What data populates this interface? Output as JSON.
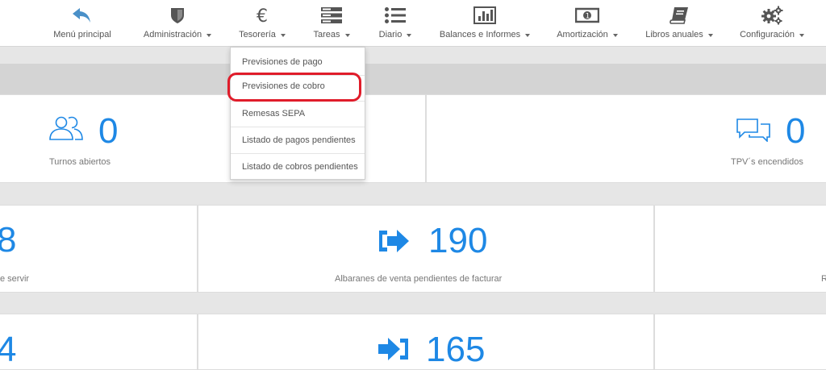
{
  "nav": {
    "items": [
      {
        "label": "Menú principal",
        "has_caret": false,
        "icon": "arrow-back-icon"
      },
      {
        "label": "Administración",
        "has_caret": true,
        "icon": "shield-icon"
      },
      {
        "label": "Tesorería",
        "has_caret": true,
        "icon": "euro-icon"
      },
      {
        "label": "Tareas",
        "has_caret": true,
        "icon": "server-icon"
      },
      {
        "label": "Diario",
        "has_caret": true,
        "icon": "list-icon"
      },
      {
        "label": "Balances e Informes",
        "has_caret": true,
        "icon": "bar-chart-icon"
      },
      {
        "label": "Amortización",
        "has_caret": true,
        "icon": "money-icon"
      },
      {
        "label": "Libros anuales",
        "has_caret": true,
        "icon": "book-icon"
      },
      {
        "label": "Configuración",
        "has_caret": true,
        "icon": "gears-icon"
      }
    ]
  },
  "dropdown": {
    "items": [
      "Previsiones de pago",
      "Previsiones de cobro",
      "Remesas SEPA",
      "Listado de pagos pendientes",
      "Listado de cobros pendientes"
    ],
    "highlighted": "Previsiones de cobro"
  },
  "stats": {
    "turnos": {
      "value": "0",
      "label": "Turnos abiertos"
    },
    "tpv": {
      "value": "0",
      "label": "TPV´s encendidos"
    },
    "left_mid": {
      "value": "8",
      "label": "e servir"
    },
    "albaranes_venta": {
      "value": "190",
      "label": "Albaranes de venta pendientes de facturar"
    },
    "right_mid": {
      "label": "R"
    },
    "left_bottom": {
      "value": "4"
    },
    "albaranes_compra": {
      "value": "165"
    }
  },
  "colors": {
    "accent": "#1e88e5",
    "nav_icon": "#555555",
    "back_icon": "#4a90c8",
    "highlight": "#e01c2a"
  }
}
